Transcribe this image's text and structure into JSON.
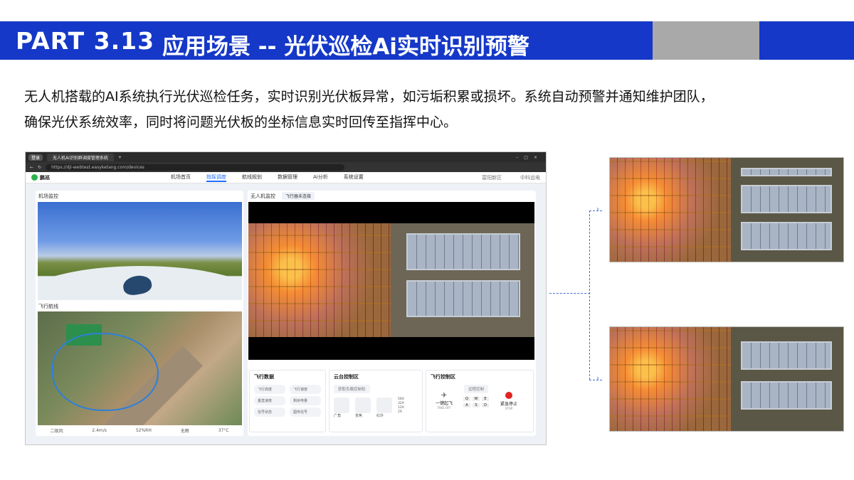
{
  "header": {
    "part": "PART 3.13",
    "title": "应用场景 -- 光伏巡检Ai实时识别预警"
  },
  "intro": {
    "line1": "无人机搭载的AI系统执行光伏巡检任务，实时识别光伏板异常，如污垢积累或损坏。系统自动预警并通知维护团队，",
    "line2": "确保光伏系统效率，同时将问题光伏板的坐标信息实时回传至指挥中心。"
  },
  "browser": {
    "tab_pill": "登录",
    "tab_title": "无人机AI识别群调度管理系统",
    "url": "https://dji-webtest.easyketang.com/devices",
    "app_name": "鹏巡",
    "menu": [
      "机场首页",
      "指挥调度",
      "航线规划",
      "数据管理",
      "Ai分析",
      "系统设置"
    ],
    "active_menu": "指挥调度",
    "region": "富阳新区",
    "user": "中科远电"
  },
  "left_panel": {
    "airport_label": "机场监控",
    "route_label": "飞行航线",
    "status": [
      "二级风",
      "2.4m/s",
      "52%RH",
      "无雨",
      "37°C"
    ]
  },
  "right_panel": {
    "monitor_label": "无人机监控",
    "monitor_tab": "飞行器未连接",
    "flight_data": {
      "title": "飞行数据",
      "cells": [
        "飞行高度",
        "飞行速度",
        "垂直速度",
        "剩余电量",
        "信号状态",
        "图传信号"
      ]
    },
    "gimbal": {
      "title": "云台控制区",
      "sub": "获取负载控制权",
      "modes": [
        "广角",
        "变焦",
        "红外"
      ],
      "zoom": [
        "56X",
        "48X",
        "32X",
        "24X",
        "12X",
        "2X"
      ]
    },
    "flight_control": {
      "title": "飞行控制区",
      "sub": "远程控制",
      "takeoff": "一键起飞",
      "takeoff_en": "TAKE OFF",
      "stop": "紧急停止",
      "stop_en": "STOP",
      "keys": [
        "Q",
        "W",
        "E",
        "A",
        "S",
        "D"
      ]
    }
  }
}
